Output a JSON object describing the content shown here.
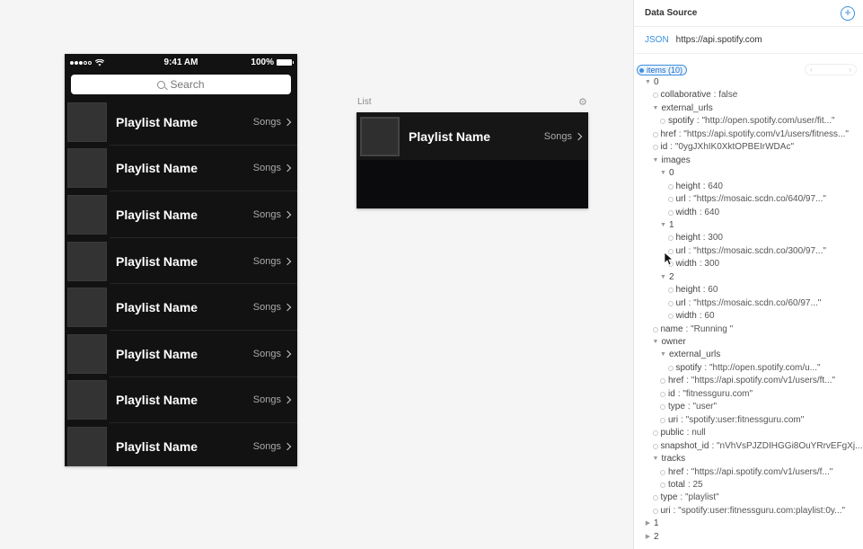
{
  "phone": {
    "time": "9:41 AM",
    "battery": "100%",
    "search_placeholder": "Search",
    "rows": [
      {
        "name": "Playlist Name",
        "songs": "Songs"
      },
      {
        "name": "Playlist Name",
        "songs": "Songs"
      },
      {
        "name": "Playlist Name",
        "songs": "Songs"
      },
      {
        "name": "Playlist Name",
        "songs": "Songs"
      },
      {
        "name": "Playlist Name",
        "songs": "Songs"
      },
      {
        "name": "Playlist Name",
        "songs": "Songs"
      },
      {
        "name": "Playlist Name",
        "songs": "Songs"
      },
      {
        "name": "Playlist Name",
        "songs": "Songs"
      }
    ]
  },
  "list": {
    "label": "List",
    "row": {
      "name": "Playlist Name",
      "songs": "Songs"
    }
  },
  "panel": {
    "title": "Data Source",
    "source_type": "JSON",
    "source_url": "https://api.spotify.com",
    "items_label": "items (10)",
    "tree": [
      {
        "indent": 0,
        "marker": "open",
        "key": "0",
        "value": ""
      },
      {
        "indent": 1,
        "marker": "dot",
        "key": "collaborative",
        "value": ": false"
      },
      {
        "indent": 1,
        "marker": "open",
        "key": "external_urls",
        "value": ""
      },
      {
        "indent": 2,
        "marker": "dot",
        "key": "spotify",
        "value": ": \"http://open.spotify.com/user/fit...\""
      },
      {
        "indent": 1,
        "marker": "dot",
        "key": "href",
        "value": ": \"https://api.spotify.com/v1/users/fitness...\""
      },
      {
        "indent": 1,
        "marker": "dot",
        "key": "id",
        "value": ": \"0ygJXhIK0XktOPBEIrWDAc\""
      },
      {
        "indent": 1,
        "marker": "open",
        "key": "images",
        "value": ""
      },
      {
        "indent": 2,
        "marker": "open",
        "key": "0",
        "value": ""
      },
      {
        "indent": 3,
        "marker": "dot",
        "key": "height",
        "value": ": 640"
      },
      {
        "indent": 3,
        "marker": "dot",
        "key": "url",
        "value": ": \"https://mosaic.scdn.co/640/97...\""
      },
      {
        "indent": 3,
        "marker": "dot",
        "key": "width",
        "value": ": 640"
      },
      {
        "indent": 2,
        "marker": "open",
        "key": "1",
        "value": ""
      },
      {
        "indent": 3,
        "marker": "dot",
        "key": "height",
        "value": ": 300"
      },
      {
        "indent": 3,
        "marker": "dot",
        "key": "url",
        "value": ": \"https://mosaic.scdn.co/300/97...\""
      },
      {
        "indent": 3,
        "marker": "dot",
        "key": "width",
        "value": ": 300"
      },
      {
        "indent": 2,
        "marker": "open",
        "key": "2",
        "value": ""
      },
      {
        "indent": 3,
        "marker": "dot",
        "key": "height",
        "value": ": 60"
      },
      {
        "indent": 3,
        "marker": "dot",
        "key": "url",
        "value": ": \"https://mosaic.scdn.co/60/97...\""
      },
      {
        "indent": 3,
        "marker": "dot",
        "key": "width",
        "value": ": 60"
      },
      {
        "indent": 1,
        "marker": "dot",
        "key": "name",
        "value": ": \"Running \""
      },
      {
        "indent": 1,
        "marker": "open",
        "key": "owner",
        "value": ""
      },
      {
        "indent": 2,
        "marker": "open",
        "key": "external_urls",
        "value": ""
      },
      {
        "indent": 3,
        "marker": "dot",
        "key": "spotify",
        "value": ": \"http://open.spotify.com/u...\""
      },
      {
        "indent": 2,
        "marker": "dot",
        "key": "href",
        "value": ": \"https://api.spotify.com/v1/users/ft...\""
      },
      {
        "indent": 2,
        "marker": "dot",
        "key": "id",
        "value": ": \"fitnessguru.com\""
      },
      {
        "indent": 2,
        "marker": "dot",
        "key": "type",
        "value": ": \"user\""
      },
      {
        "indent": 2,
        "marker": "dot",
        "key": "uri",
        "value": ": \"spotify:user:fitnessguru.com\""
      },
      {
        "indent": 1,
        "marker": "dot",
        "key": "public",
        "value": ": null"
      },
      {
        "indent": 1,
        "marker": "dot",
        "key": "snapshot_id",
        "value": ": \"nVhVsPJZDIHGGi8OuYRrvEFgXj...\""
      },
      {
        "indent": 1,
        "marker": "open",
        "key": "tracks",
        "value": ""
      },
      {
        "indent": 2,
        "marker": "dot",
        "key": "href",
        "value": ": \"https://api.spotify.com/v1/users/f...\""
      },
      {
        "indent": 2,
        "marker": "dot",
        "key": "total",
        "value": ": 25"
      },
      {
        "indent": 1,
        "marker": "dot",
        "key": "type",
        "value": ": \"playlist\""
      },
      {
        "indent": 1,
        "marker": "dot",
        "key": "uri",
        "value": ": \"spotify:user:fitnessguru.com:playlist:0y...\""
      },
      {
        "indent": 0,
        "marker": "closed",
        "key": "1",
        "value": ""
      },
      {
        "indent": 0,
        "marker": "closed",
        "key": "2",
        "value": ""
      }
    ]
  },
  "colors": {
    "accent": "#3b8fe0",
    "phone_bg": "#121212",
    "row_thumb": "#333333"
  }
}
